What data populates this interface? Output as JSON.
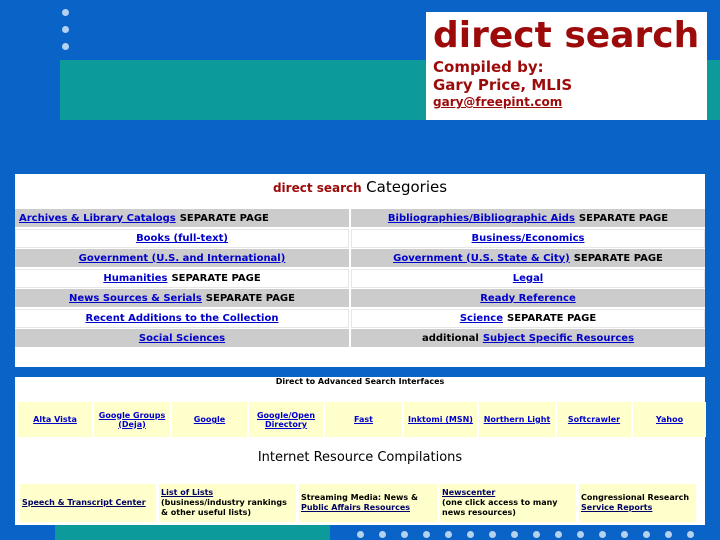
{
  "header": {
    "brand": "direct search",
    "compiled_by": "Compiled by:",
    "author": "Gary Price, MLIS",
    "email": "gary@freepint.com"
  },
  "categories": {
    "heading_brand": "direct search",
    "heading_text": "Categories",
    "rows": [
      {
        "left": {
          "link": "Archives & Library Catalogs",
          "suffix": "SEPARATE PAGE"
        },
        "right": {
          "link": "Bibliographies/Bibliographic Aids",
          "suffix": "SEPARATE PAGE"
        }
      },
      {
        "left": {
          "link": "Books (full-text)",
          "suffix": ""
        },
        "right": {
          "link": "Business/Economics",
          "suffix": ""
        }
      },
      {
        "left": {
          "link": "Government (U.S. and International)",
          "suffix": ""
        },
        "right": {
          "link": "Government (U.S. State & City)",
          "suffix": "SEPARATE PAGE"
        }
      },
      {
        "left": {
          "link": "Humanities",
          "suffix": "SEPARATE PAGE"
        },
        "right": {
          "link": "Legal",
          "suffix": ""
        }
      },
      {
        "left": {
          "link": "News Sources & Serials",
          "suffix": "SEPARATE PAGE"
        },
        "right": {
          "link": "Ready Reference",
          "suffix": ""
        }
      },
      {
        "left": {
          "link": "Recent Additions to the Collection",
          "suffix": ""
        },
        "right": {
          "link": "Science",
          "suffix": "SEPARATE PAGE"
        }
      },
      {
        "left": {
          "link": "Social Sciences",
          "suffix": ""
        },
        "right": {
          "prefix": "additional",
          "link": "Subject Specific Resources",
          "suffix": ""
        }
      }
    ]
  },
  "advanced": {
    "title": "Direct to Advanced Search Interfaces",
    "engines": [
      "Alta Vista",
      "Google Groups (Deja)",
      "Google",
      "Google/Open Directory",
      "Fast",
      "Inktomi (MSN)",
      "Northern Light",
      "Softcrawler",
      "Yahoo"
    ]
  },
  "compilations": {
    "title": "Internet Resource Compilations",
    "items": [
      {
        "link": "Speech & Transcript Center",
        "text": ""
      },
      {
        "link": "List of Lists",
        "text": "(business/industry rankings & other useful lists)"
      },
      {
        "pre": "Streaming Media: News &",
        "link": "Public Affairs Resources",
        "text": ""
      },
      {
        "link": "Newscenter",
        "text": "(one click access to many news resources)"
      },
      {
        "pre": "Congressional Research",
        "link": "Service Reports",
        "text": ""
      }
    ]
  },
  "colors": {
    "background": "#0a64c8",
    "teal": "#0c9a9a",
    "brand_red": "#9c0a0a",
    "link_blue": "#0000cc"
  }
}
